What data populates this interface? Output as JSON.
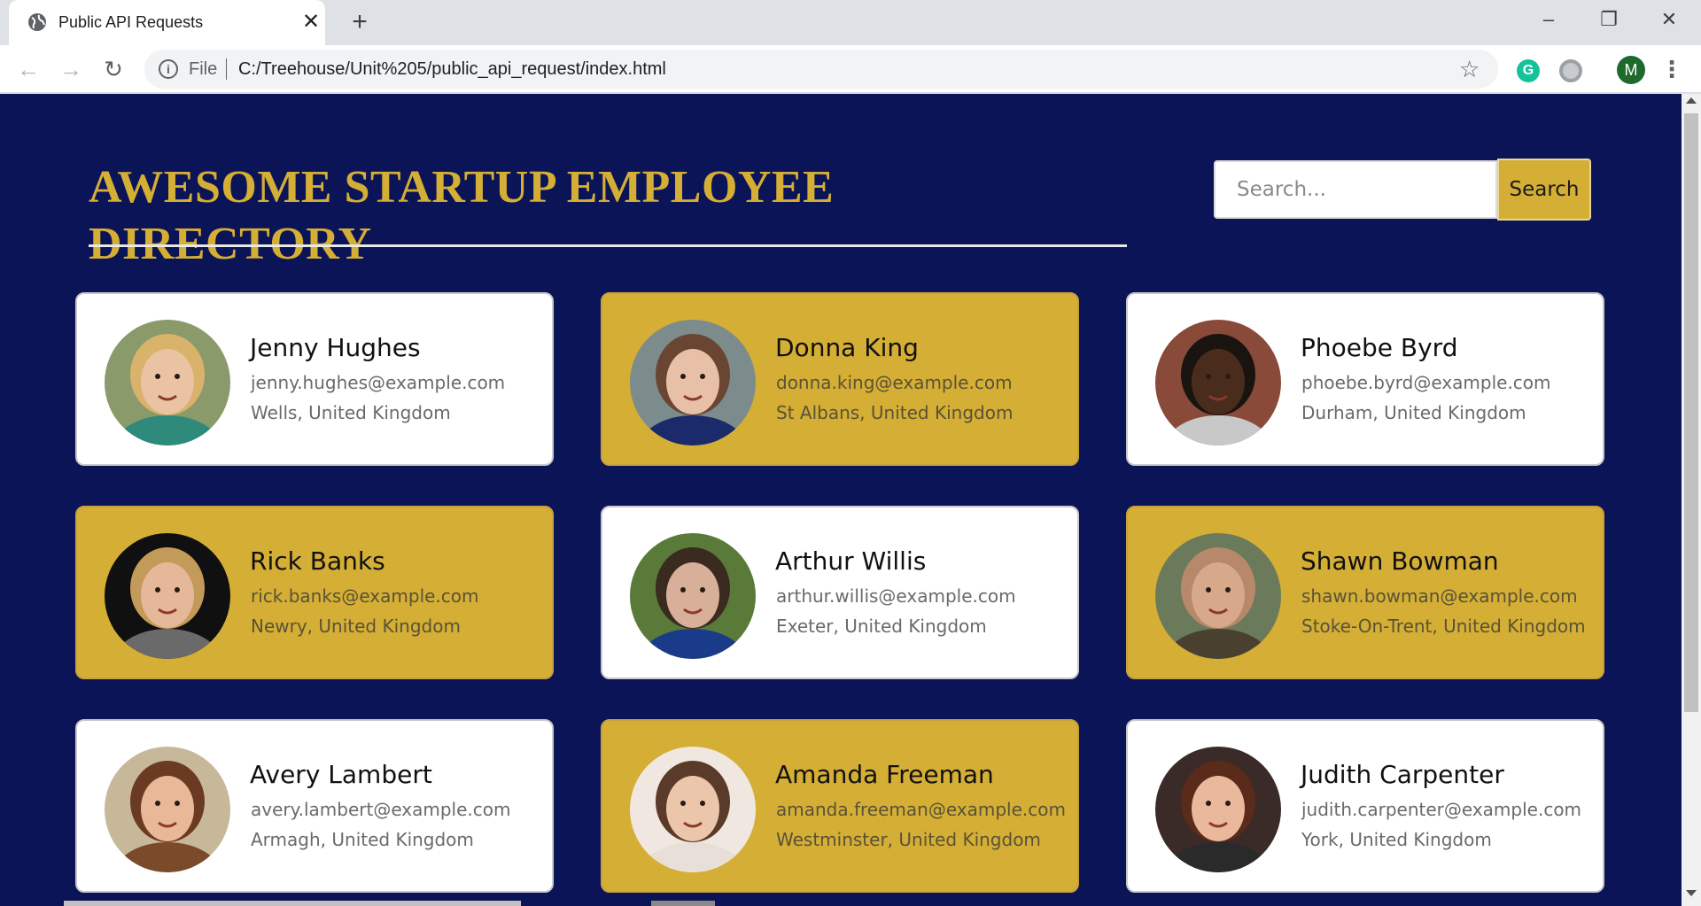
{
  "browser": {
    "tab_title": "Public API Requests",
    "tab_close": "✕",
    "new_tab": "+",
    "minimize": "–",
    "restore": "❐",
    "close": "✕",
    "back": "←",
    "forward": "→",
    "reload": "↻",
    "info": "i",
    "scheme": "File",
    "url": "C:/Treehouse/Unit%205/public_api_request/index.html",
    "star": "☆",
    "ext_grammarly": "G",
    "profile_initial": "M",
    "menu": "⋮"
  },
  "page": {
    "heading": "AWESOME STARTUP EMPLOYEE DIRECTORY",
    "search_placeholder": "Search...",
    "search_button": "Search",
    "colors": {
      "background": "#0c1458",
      "accent": "#d4ae35"
    }
  },
  "employees": [
    {
      "name": "Jenny Hughes",
      "email": "jenny.hughes@example.com",
      "location": "Wells, United Kingdom",
      "highlight": false,
      "skin": "#eac3a2",
      "hair": "#d9b36b",
      "bg": "#8a9a6a",
      "shirt": "#2e8a7a"
    },
    {
      "name": "Donna King",
      "email": "donna.king@example.com",
      "location": "St Albans, United Kingdom",
      "highlight": true,
      "skin": "#e8c0a8",
      "hair": "#6a4632",
      "bg": "#7c8c8c",
      "shirt": "#1a2a6a"
    },
    {
      "name": "Phoebe Byrd",
      "email": "phoebe.byrd@example.com",
      "location": "Durham, United Kingdom",
      "highlight": false,
      "skin": "#4a2c1c",
      "hair": "#1a1410",
      "bg": "#8a4a3a",
      "shirt": "#c8c8c8"
    },
    {
      "name": "Rick Banks",
      "email": "rick.banks@example.com",
      "location": "Newry, United Kingdom",
      "highlight": true,
      "skin": "#e6b89a",
      "hair": "#c49a5a",
      "bg": "#101010",
      "shirt": "#6a6a6a"
    },
    {
      "name": "Arthur Willis",
      "email": "arthur.willis@example.com",
      "location": "Exeter, United Kingdom",
      "highlight": false,
      "skin": "#d8b09a",
      "hair": "#3a2a20",
      "bg": "#5a7a3a",
      "shirt": "#1a3a8a"
    },
    {
      "name": "Shawn Bowman",
      "email": "shawn.bowman@example.com",
      "location": "Stoke-On-Trent, United Kingdom",
      "highlight": true,
      "skin": "#d8a88a",
      "hair": "#b8886a",
      "bg": "#6a7a5a",
      "shirt": "#4a4030"
    },
    {
      "name": "Avery Lambert",
      "email": "avery.lambert@example.com",
      "location": "Armagh, United Kingdom",
      "highlight": false,
      "skin": "#e8b898",
      "hair": "#6a3a22",
      "bg": "#c8b89a",
      "shirt": "#7a4a2a"
    },
    {
      "name": "Amanda Freeman",
      "email": "amanda.freeman@example.com",
      "location": "Westminster, United Kingdom",
      "highlight": true,
      "skin": "#ecc6aa",
      "hair": "#5a3a28",
      "bg": "#f0e8e0",
      "shirt": "#e8e0d8"
    },
    {
      "name": "Judith Carpenter",
      "email": "judith.carpenter@example.com",
      "location": "York, United Kingdom",
      "highlight": false,
      "skin": "#eab89a",
      "hair": "#5a2a1a",
      "bg": "#3a2a28",
      "shirt": "#2a2a2a"
    }
  ]
}
